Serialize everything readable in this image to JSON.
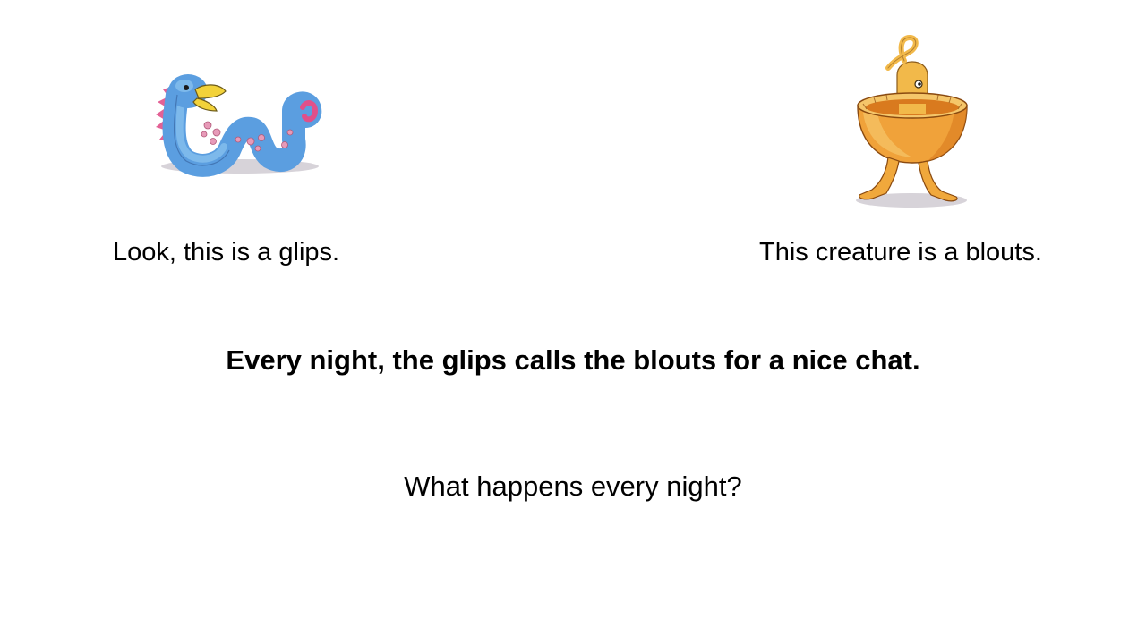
{
  "slide": {
    "glips_caption": "Look, this is a glips.",
    "blouts_caption": "This creature is a blouts.",
    "statement": "Every night, the glips calls the blouts for a nice chat.",
    "question": "What happens every night?"
  },
  "illustrations": {
    "glips": {
      "icon": "blue-serpent-creature-icon",
      "colors": {
        "body": "#5b9ee0",
        "body_light": "#8cc4f0",
        "beak": "#f2d23a",
        "crest": "#e0508a",
        "spots": "#e79ab8",
        "shadow": "#c9c4cc"
      }
    },
    "blouts": {
      "icon": "orange-bowl-creature-icon",
      "colors": {
        "bowl": "#f0a23a",
        "bowl_dark": "#d97a1e",
        "bowl_rim": "#f5c66a",
        "creature": "#f2b94a",
        "legs": "#f0a83c",
        "shadow": "#c9c4cc"
      }
    }
  }
}
